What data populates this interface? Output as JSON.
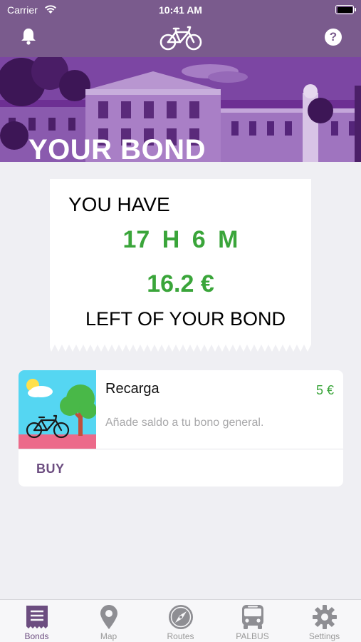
{
  "status_bar": {
    "carrier": "Carrier",
    "time": "10:41 AM"
  },
  "nav": {
    "help_label": "?",
    "icons": [
      "bell-icon",
      "bicycle-logo-icon",
      "help-icon"
    ]
  },
  "hero": {
    "title": "YOUR BOND"
  },
  "balance": {
    "intro": "YOU HAVE",
    "time_left": "17 H  6 M",
    "money_left": "16.2 €",
    "outro": "LEFT OF YOUR BOND"
  },
  "bond_card": {
    "title": "Recarga",
    "price": "5 €",
    "description": "Añade saldo a tu bono general.",
    "buy_label": "BUY"
  },
  "tabs": [
    {
      "label": "Bonds",
      "icon": "ticket-icon",
      "active": true
    },
    {
      "label": "Map",
      "icon": "map-pin-icon",
      "active": false
    },
    {
      "label": "Routes",
      "icon": "compass-icon",
      "active": false
    },
    {
      "label": "PALBUS",
      "icon": "bus-icon",
      "active": false
    },
    {
      "label": "Settings",
      "icon": "gear-icon",
      "active": false
    }
  ],
  "colors": {
    "brand": "#7a5b8d",
    "accent": "#6c4d80",
    "positive": "#3aa53a",
    "background": "#efeff3"
  }
}
